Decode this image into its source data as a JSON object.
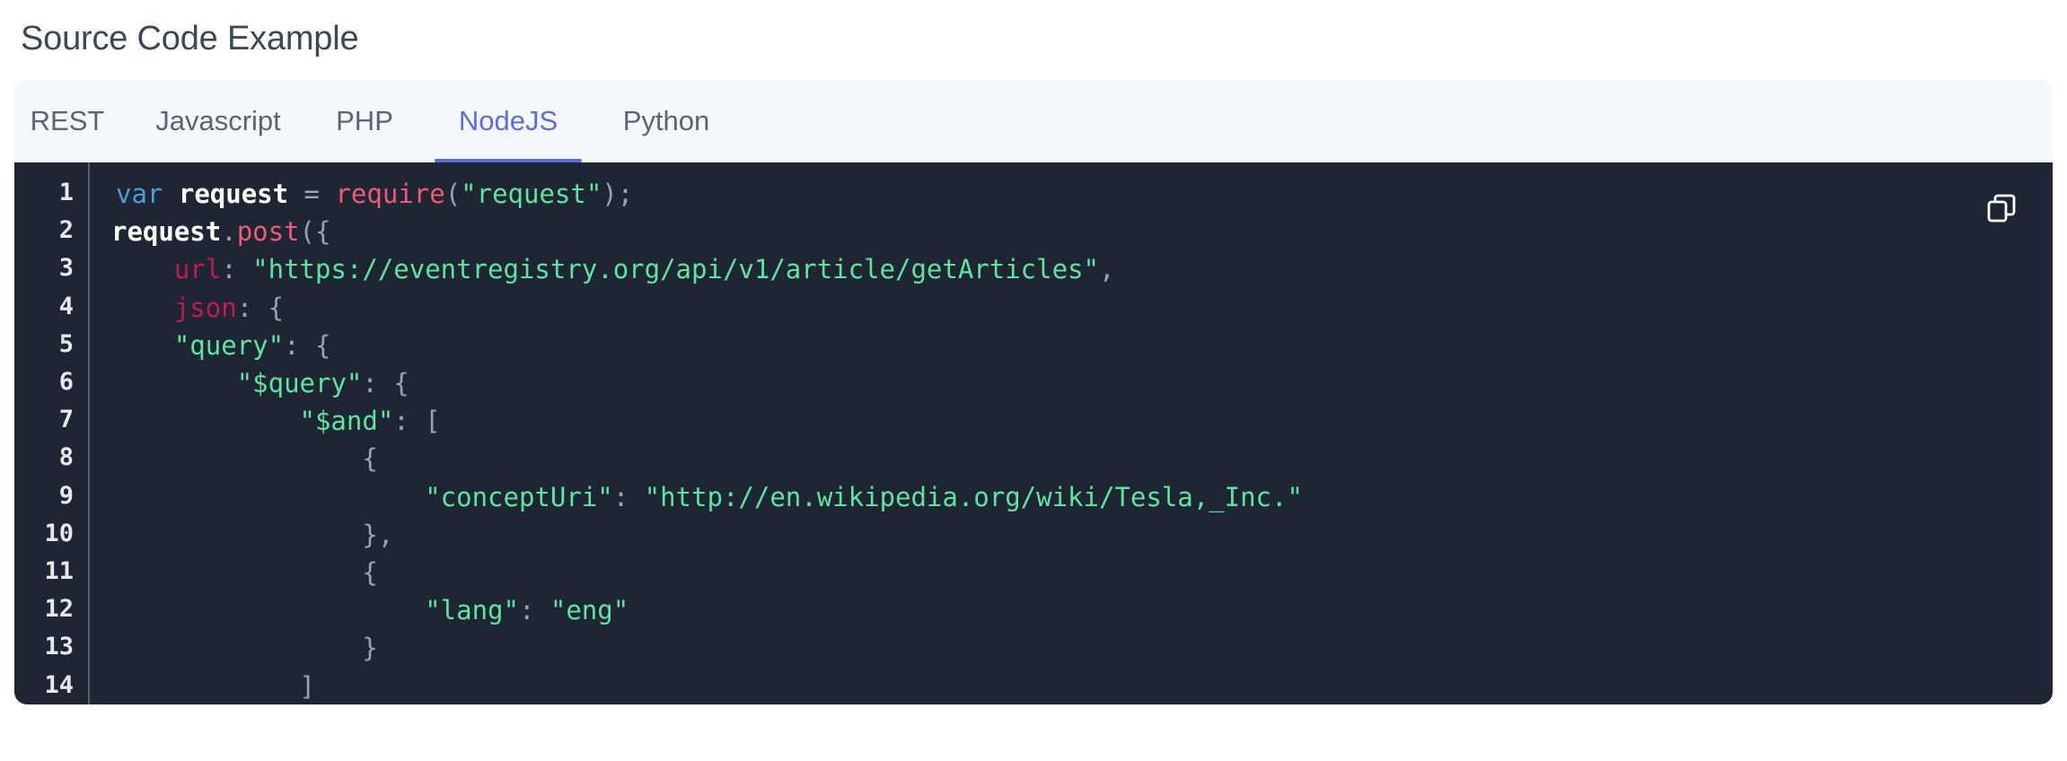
{
  "section_title": "Source Code Example",
  "tabs": [
    {
      "label": "REST",
      "active": false
    },
    {
      "label": "Javascript",
      "active": false
    },
    {
      "label": "PHP",
      "active": false
    },
    {
      "label": "NodeJS",
      "active": true
    },
    {
      "label": "Python",
      "active": false
    }
  ],
  "colors": {
    "accent": "#5b6ee0",
    "code_bg": "#1f2633",
    "string": "#5fe3a1",
    "keyword": "#4d9bd8",
    "function": "#ef5a74",
    "property": "#c2185b"
  },
  "copy_icon": "copy-icon",
  "code": {
    "line_numbers": [
      "1",
      "2",
      "3",
      "4",
      "5",
      "6",
      "7",
      "8",
      "9",
      "10",
      "11",
      "12",
      "13",
      "14"
    ],
    "lines": [
      [
        {
          "t": "kw",
          "v": "var"
        },
        {
          "t": "sp",
          "v": " "
        },
        {
          "t": "plain",
          "v": "request"
        },
        {
          "t": "punc",
          "v": " = "
        },
        {
          "t": "fn",
          "v": "require"
        },
        {
          "t": "punc",
          "v": "("
        },
        {
          "t": "str",
          "v": "\"request\""
        },
        {
          "t": "punc",
          "v": ");"
        }
      ],
      [
        {
          "t": "plain",
          "v": "request"
        },
        {
          "t": "punc",
          "v": "."
        },
        {
          "t": "fn",
          "v": "post"
        },
        {
          "t": "punc",
          "v": "({"
        }
      ],
      [
        {
          "t": "sp",
          "v": "    "
        },
        {
          "t": "key",
          "v": "url"
        },
        {
          "t": "punc",
          "v": ": "
        },
        {
          "t": "str",
          "v": "\"https://eventregistry.org/api/v1/article/getArticles\""
        },
        {
          "t": "punc",
          "v": ","
        }
      ],
      [
        {
          "t": "sp",
          "v": "    "
        },
        {
          "t": "key",
          "v": "json"
        },
        {
          "t": "punc",
          "v": ": {"
        }
      ],
      [
        {
          "t": "sp",
          "v": "    "
        },
        {
          "t": "str",
          "v": "\"query\""
        },
        {
          "t": "punc",
          "v": ": {"
        }
      ],
      [
        {
          "t": "sp",
          "v": "        "
        },
        {
          "t": "str",
          "v": "\"$query\""
        },
        {
          "t": "punc",
          "v": ": {"
        }
      ],
      [
        {
          "t": "sp",
          "v": "            "
        },
        {
          "t": "str",
          "v": "\"$and\""
        },
        {
          "t": "punc",
          "v": ": ["
        }
      ],
      [
        {
          "t": "sp",
          "v": "                "
        },
        {
          "t": "punc",
          "v": "{"
        }
      ],
      [
        {
          "t": "sp",
          "v": "                    "
        },
        {
          "t": "str",
          "v": "\"conceptUri\""
        },
        {
          "t": "punc",
          "v": ": "
        },
        {
          "t": "str",
          "v": "\"http://en.wikipedia.org/wiki/Tesla,_Inc.\""
        }
      ],
      [
        {
          "t": "sp",
          "v": "                "
        },
        {
          "t": "punc",
          "v": "},"
        }
      ],
      [
        {
          "t": "sp",
          "v": "                "
        },
        {
          "t": "punc",
          "v": "{"
        }
      ],
      [
        {
          "t": "sp",
          "v": "                    "
        },
        {
          "t": "str",
          "v": "\"lang\""
        },
        {
          "t": "punc",
          "v": ": "
        },
        {
          "t": "str",
          "v": "\"eng\""
        }
      ],
      [
        {
          "t": "sp",
          "v": "                "
        },
        {
          "t": "punc",
          "v": "}"
        }
      ],
      [
        {
          "t": "sp",
          "v": "            "
        },
        {
          "t": "punc",
          "v": "]"
        }
      ]
    ]
  }
}
